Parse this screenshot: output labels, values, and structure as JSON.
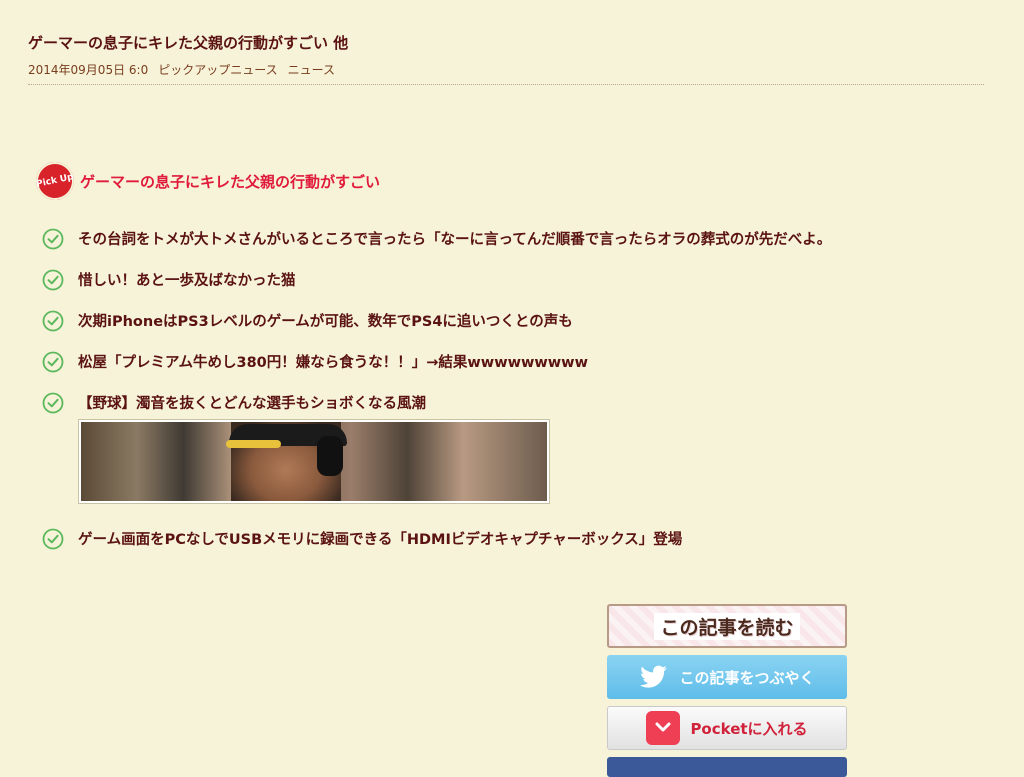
{
  "article": {
    "title": "ゲーマーの息子にキレた父親の行動がすごい 他",
    "date": "2014年09月05日 6:0",
    "category": "ピックアップニュース",
    "subcategory": "ニュース"
  },
  "pickup": {
    "badge": "Pick Up",
    "title": "ゲーマーの息子にキレた父親の行動がすごい"
  },
  "items": [
    "その台詞をトメが大トメさんがいるところで言ったら「なーに言ってんだ順番で言ったらオラの葬式のが先だべよ。",
    "惜しい！あと一歩及ばなかった猫",
    "次期iPhoneはPS3レベルのゲームが可能、数年でPS4に追いつくとの声も",
    "松屋「プレミアム牛めし380円！嫌なら食うな！！」→結果wwwwwwwww",
    "【野球】濁音を抜くとどんな選手もショボくなる風潮"
  ],
  "last_item": "ゲーム画面をPCなしでUSBメモリに録画できる「HDMIビデオキャプチャーボックス」登場",
  "share": {
    "read": "この記事を読む",
    "tweet": "この記事をつぶやく",
    "pocket": "Pocketに入れる"
  },
  "colors": {
    "background": "#f6f3d8",
    "text": "#5a1212",
    "pickup_title": "#e01a3a",
    "check": "#5cb85c"
  }
}
